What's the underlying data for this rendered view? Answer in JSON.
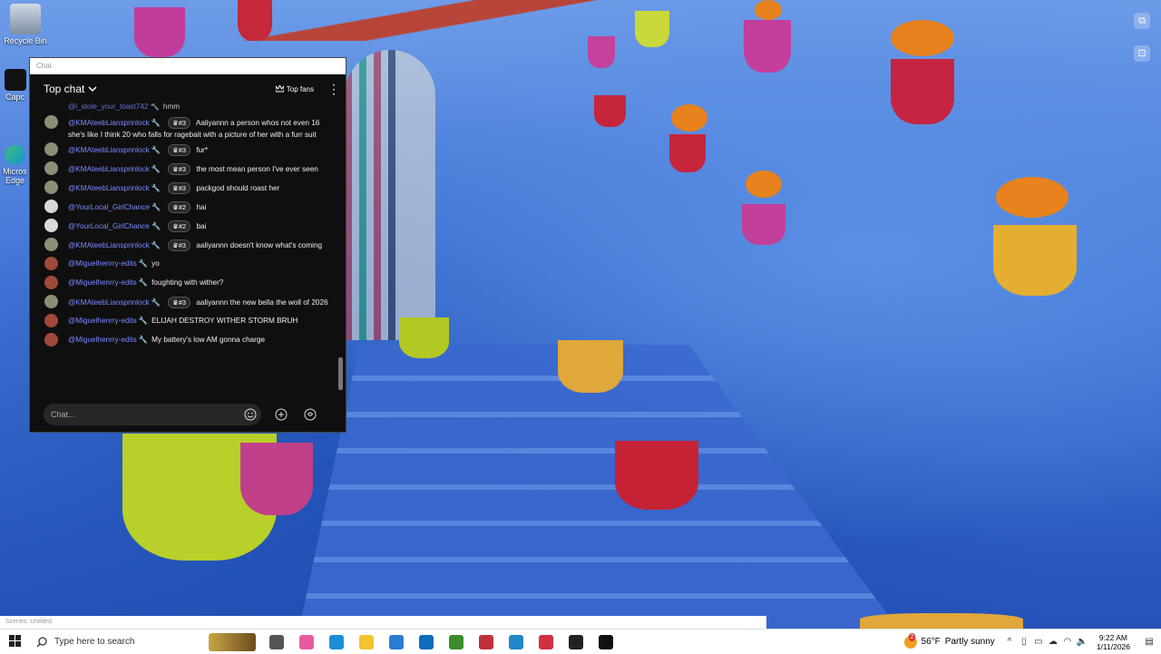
{
  "desktop": {
    "icons": [
      {
        "label": "Recycle Bin",
        "icon": "recycle-bin-icon"
      },
      {
        "label": "Capc",
        "icon": "capcut-icon"
      },
      {
        "label": "Micros Edge",
        "icon": "edge-icon"
      }
    ],
    "side_buttons": [
      "screenshot-icon",
      "focus-icon"
    ]
  },
  "chat": {
    "window_title": "Chat",
    "header_title": "Top chat",
    "top_fans_label": "Top fans",
    "input_placeholder": "Chat...",
    "partial_top_message": {
      "author": "@i_stole_your_toast742",
      "text": "hmm"
    },
    "messages": [
      {
        "author": "@KMAteebLiansprinlock",
        "badge": "#3",
        "text": "Aaliyannn a person whos not even 16 she's like I think 20 who falls for ragebait with a picture of her with a furr suit",
        "avatar_color": "#8a8f76"
      },
      {
        "author": "@KMAteebLiansprinlock",
        "badge": "#3",
        "text": "fur*",
        "avatar_color": "#8a8f76"
      },
      {
        "author": "@KMAteebLiansprinlock",
        "badge": "#3",
        "text": "the most mean person I've ever seen",
        "avatar_color": "#8a8f76"
      },
      {
        "author": "@KMAteebLiansprinlock",
        "badge": "#3",
        "text": "packgod should roast her",
        "avatar_color": "#8a8f76"
      },
      {
        "author": "@YourLocal_GirlChance",
        "badge": "#2",
        "text": "hai",
        "avatar_color": "#d9d9d9"
      },
      {
        "author": "@YourLocal_GirlChance",
        "badge": "#2",
        "text": "bai",
        "avatar_color": "#d9d9d9"
      },
      {
        "author": "@KMAteebLiansprinlock",
        "badge": "#3",
        "text": "aaliyannn doesn't know what's coming",
        "avatar_color": "#8a8f76"
      },
      {
        "author": "@Miguelhenrry-edits",
        "badge": "",
        "text": "yo",
        "avatar_color": "#a0493a"
      },
      {
        "author": "@Miguelhenrry-edits",
        "badge": "",
        "text": "foughting with wither?",
        "avatar_color": "#a0493a"
      },
      {
        "author": "@KMAteebLiansprinlock",
        "badge": "#3",
        "text": "aaliyannn the new bella the woll of 2026",
        "avatar_color": "#8a8f76"
      },
      {
        "author": "@Miguelhenrry-edits",
        "badge": "",
        "text": "ELIJAH DESTROY WITHER STORM BRUH",
        "avatar_color": "#a0493a"
      },
      {
        "author": "@Miguelhenrry-edits",
        "badge": "",
        "text": "My battery's low AM gonna charge",
        "avatar_color": "#a0493a"
      }
    ]
  },
  "scene_strip": "Scenes: Untitled",
  "taskbar": {
    "search_placeholder": "Type here to search",
    "apps": [
      {
        "icon": "task-view-icon",
        "color": "#555555"
      },
      {
        "icon": "copilot-icon",
        "color": "#e85aa0"
      },
      {
        "icon": "edge-icon",
        "color": "#1a8fd6"
      },
      {
        "icon": "file-explorer-icon",
        "color": "#f2c230"
      },
      {
        "icon": "store-icon",
        "color": "#2b7cd3"
      },
      {
        "icon": "outlook-icon",
        "color": "#0f6cbd"
      },
      {
        "icon": "minecraft-icon",
        "color": "#3c8c2c"
      },
      {
        "icon": "roblox-red-icon",
        "color": "#c0303a"
      },
      {
        "icon": "roblox-studio-icon",
        "color": "#1e88c8"
      },
      {
        "icon": "red-app-icon",
        "color": "#d03040"
      },
      {
        "icon": "obs-icon",
        "color": "#222222"
      },
      {
        "icon": "capcut-icon",
        "color": "#111111"
      }
    ],
    "weather": {
      "badge": "2",
      "temp": "56°F",
      "condition": "Partly sunny"
    },
    "clock": {
      "time": "9:22 AM",
      "date": "1/11/2026"
    }
  }
}
